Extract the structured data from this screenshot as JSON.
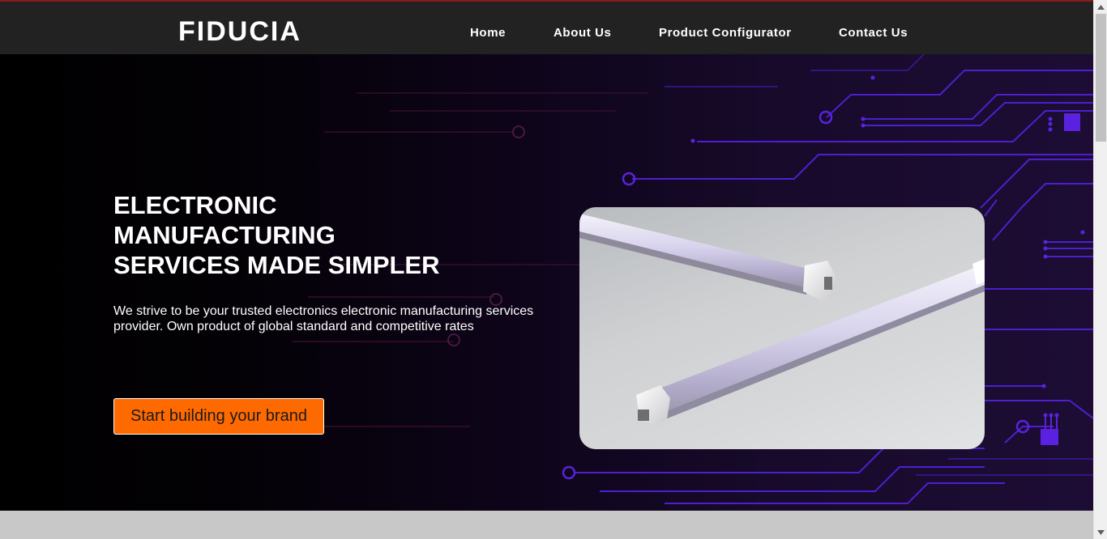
{
  "header": {
    "brand": "FIDUCIA",
    "nav": [
      {
        "label": "Home"
      },
      {
        "label": "About Us"
      },
      {
        "label": "Product Configurator"
      },
      {
        "label": "Contact Us"
      }
    ]
  },
  "hero": {
    "headline_lines": [
      "ELECTRONIC",
      "MANUFACTURING",
      "SERVICES MADE SIMPLER"
    ],
    "subtext": "We strive to be your trusted electronics electronic manufacturing services provider. Own product of global standard and competitive rates",
    "cta_label": "Start building your brand",
    "product_image": "led-tube-lights"
  },
  "colors": {
    "nav_bg": "#222222",
    "cta": "#ff6a00",
    "circuit_accent": "#5a22e0"
  }
}
